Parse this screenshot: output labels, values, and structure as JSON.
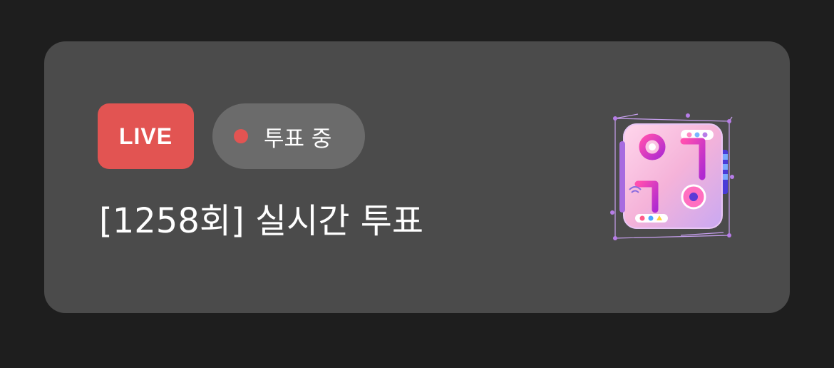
{
  "card": {
    "live_label": "LIVE",
    "status_label": "투표 중",
    "title": "[1258회] 실시간 투표",
    "thumbnail_icon": "show-logo-3d-icon"
  },
  "colors": {
    "page_bg": "#1e1e1e",
    "card_bg": "#4b4b4b",
    "live_red": "#e25452",
    "pill_bg": "#6b6b6b",
    "text": "#ffffff"
  }
}
